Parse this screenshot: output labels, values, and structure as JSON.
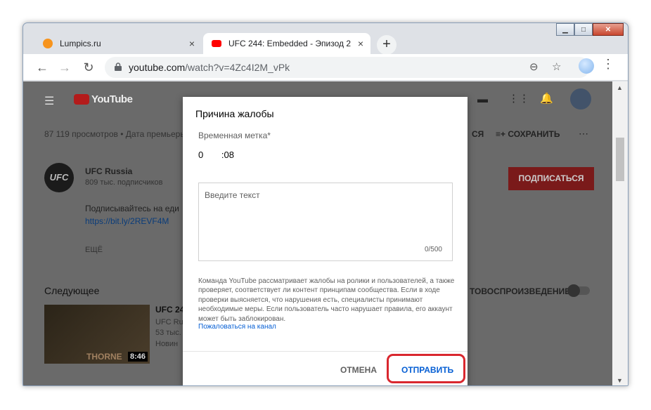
{
  "browser": {
    "tabs": [
      {
        "label": "Lumpics.ru",
        "close": "×",
        "icon_color": "#f7941d"
      },
      {
        "label": "UFC 244: Embedded - Эпизод 2",
        "close": "×",
        "icon_color": "#ff0000"
      }
    ],
    "new_tab": "+",
    "url_host": "youtube.com",
    "url_path": "/watch?v=4Zc4I2M_vPk"
  },
  "youtube": {
    "logo": "YouTube",
    "views": "87 119 просмотров • Дата премьеры",
    "save": "СОХРАНИТЬ",
    "share_partial": "СЯ",
    "channel_name": "UFC Russia",
    "subscribers": "809 тыс. подписчиков",
    "subscribe": "ПОДПИСАТЬСЯ",
    "desc_line": "Подписывайтесь на еди",
    "desc_link": "https://bit.ly/2REVF4M",
    "more": "ЕЩЁ",
    "next_title": "Следующее",
    "autoplay": "ТОВОСПРОИЗВЕДЕНИЕ",
    "rec_title": "UFC 24",
    "rec_channel": "UFC Ru",
    "rec_views": "53 тыс.",
    "rec_new": "Новин",
    "thumb_text": "THORNE",
    "duration": "8:46",
    "channel_avatar": "UFC"
  },
  "dialog": {
    "title": "Причина жалобы",
    "timestamp_label": "Временная метка*",
    "timestamp_min": "0",
    "timestamp_sep": ":08",
    "textarea_placeholder": "Введите текст",
    "counter": "0/500",
    "info": "Команда YouTube рассматривает жалобы на ролики и пользователей, а также проверяет, соответствует ли контент принципам сообщества. Если в ходе проверки выясняется, что нарушения есть, специалисты принимают необходимые меры. Если пользователь часто нарушает правила, его аккаунт может быть заблокирован.",
    "report_channel": "Пожаловаться на канал",
    "cancel": "ОТМЕНА",
    "send": "ОТПРАВИТЬ"
  },
  "colors": {
    "highlight": "#d9272e",
    "link": "#065fd4",
    "subscribe_bg": "#7a1a1a"
  }
}
